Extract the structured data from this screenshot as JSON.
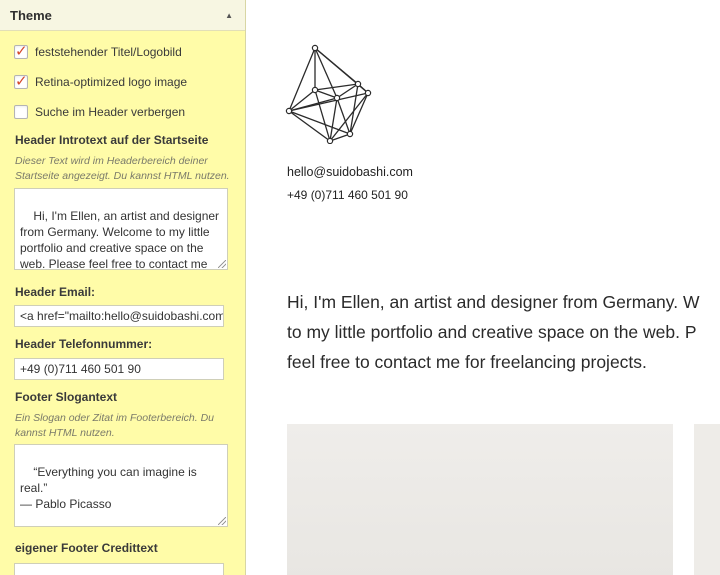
{
  "panel": {
    "title": "Theme",
    "checkboxes": [
      {
        "label": "feststehender Titel/Logobild",
        "checked": true
      },
      {
        "label": "Retina-optimized logo image",
        "checked": true
      },
      {
        "label": "Suche im Header verbergen",
        "checked": false
      }
    ],
    "intro": {
      "label": "Header Introtext auf der Startseite",
      "description": "Dieser Text wird im Headerbereich deiner Startseite angezeigt. Du kannst HTML nutzen.",
      "value": "Hi, I'm Ellen, an artist and designer\nfrom Germany. Welcome to my little\nportfolio and creative space on the\nweb. Please feel free to contact me\nfor freelancing projects."
    },
    "email": {
      "label": "Header Email:",
      "value": "<a href=\"mailto:hello@suidobashi.com"
    },
    "phone": {
      "label": "Header Telefonnummer:",
      "value": "+49 (0)711 460 501 90"
    },
    "slogan": {
      "label": "Footer Slogantext",
      "description": "Ein Slogan oder Zitat im Footerbereich. Du kannst HTML nutzen.",
      "value": "“Everything you can imagine is real.”\n— Pablo Picasso"
    },
    "credit": {
      "label": "eigener Footer Credittext"
    }
  },
  "preview": {
    "email": "hello@suidobashi.com",
    "phone": "+49 (0)711 460 501 90",
    "intro_lines": [
      "Hi, I'm Ellen, an artist and designer from Germany. W",
      "to my little portfolio and creative space on the web. P",
      "feel free to contact me for freelancing projects."
    ]
  },
  "colors": {
    "panel_bg": "#fffca8",
    "checkmark": "#d5492b",
    "text": "#2a2a2a"
  },
  "icons": {
    "collapse": "triangle-up",
    "logo": "geometric-polyhedron"
  }
}
